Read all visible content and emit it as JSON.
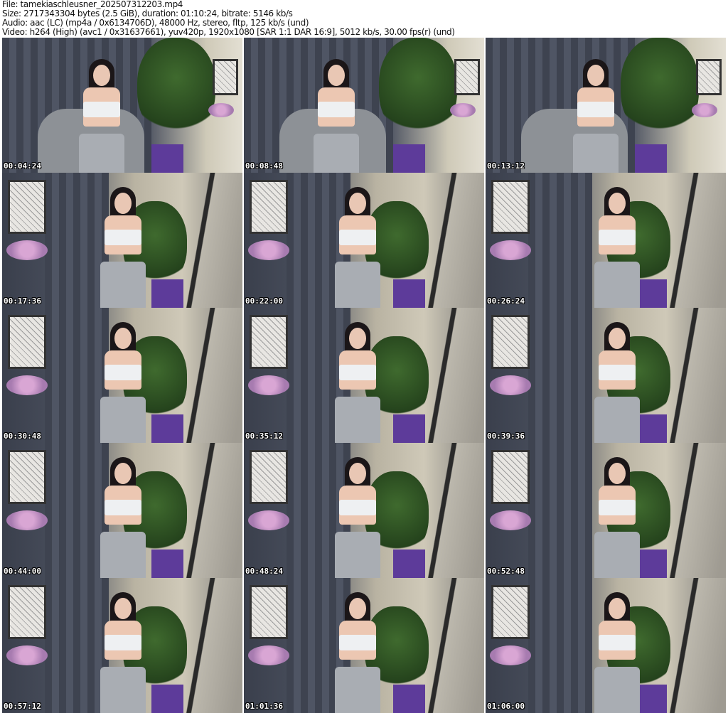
{
  "header": {
    "file": "File: tamekiaschleusner_202507312203.mp4",
    "size": "Size: 2717343304 bytes (2.5 GiB), duration: 01:10:24, bitrate: 5146 kb/s",
    "audio": "Audio: aac (LC) (mp4a / 0x6134706D), 48000 Hz, stereo, fltp, 125 kb/s (und)",
    "video": "Video: h264 (High) (avc1 / 0x31637661), yuv420p, 1920x1080 [SAR 1:1 DAR 16:9], 5012 kb/s, 30.00 fps(r) (und)"
  },
  "thumbnails": [
    {
      "timestamp": "00:04:24"
    },
    {
      "timestamp": "00:08:48"
    },
    {
      "timestamp": "00:13:12"
    },
    {
      "timestamp": "00:17:36"
    },
    {
      "timestamp": "00:22:00"
    },
    {
      "timestamp": "00:26:24"
    },
    {
      "timestamp": "00:30:48"
    },
    {
      "timestamp": "00:35:12"
    },
    {
      "timestamp": "00:39:36"
    },
    {
      "timestamp": "00:44:00"
    },
    {
      "timestamp": "00:48:24"
    },
    {
      "timestamp": "00:52:48"
    },
    {
      "timestamp": "00:57:12"
    },
    {
      "timestamp": "01:01:36"
    },
    {
      "timestamp": "01:06:00"
    }
  ]
}
